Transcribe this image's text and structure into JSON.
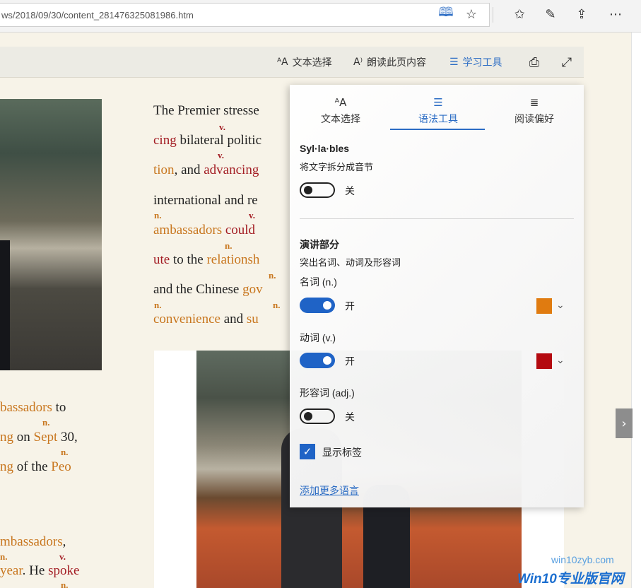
{
  "address_bar": {
    "url": "ws/2018/09/30/content_281476325081986.htm",
    "icons": [
      "reading-view-icon",
      "favorite-star-icon",
      "favorites-list-icon",
      "ink-pen-icon",
      "share-icon",
      "more-icon"
    ]
  },
  "reading_toolbar": {
    "text_options": "文本选择",
    "read_aloud": "朗读此页内容",
    "learning_tools": "学习工具",
    "icons": [
      "text-size-icon",
      "read-aloud-icon",
      "learning-tools-icon",
      "print-icon",
      "fullscreen-icon"
    ]
  },
  "article": {
    "lines": [
      {
        "segments": [
          {
            "t": "The Premier stresse",
            "c": "plain"
          }
        ]
      },
      {
        "segments": [
          {
            "t": "cing",
            "c": "verb"
          },
          {
            "t": " bilateral politic",
            "c": "plain"
          }
        ]
      },
      {
        "segments": [
          {
            "t": "tion",
            "c": "noun"
          },
          {
            "t": ", and ",
            "c": "plain"
          },
          {
            "t": "advancing",
            "c": "verb"
          }
        ]
      },
      {
        "segments": [
          {
            "t": "international and re",
            "c": "plain"
          }
        ]
      },
      {
        "segments": [
          {
            "t": "ambassadors",
            "c": "noun"
          },
          {
            "t": " ",
            "c": "plain"
          },
          {
            "t": "could",
            "c": "verb"
          }
        ]
      },
      {
        "segments": [
          {
            "t": "ute",
            "c": "verb"
          },
          {
            "t": " to the ",
            "c": "plain"
          },
          {
            "t": "relationsh",
            "c": "noun"
          }
        ]
      },
      {
        "segments": [
          {
            "t": "and the Chinese ",
            "c": "plain"
          },
          {
            "t": "gov",
            "c": "noun"
          }
        ]
      },
      {
        "segments": [
          {
            "t": "convenience",
            "c": "noun"
          },
          {
            "t": " and ",
            "c": "plain"
          },
          {
            "t": "su",
            "c": "noun"
          }
        ]
      }
    ],
    "left_lines": [
      {
        "segments": [
          {
            "t": "bassadors",
            "c": "noun"
          },
          {
            "t": " to",
            "c": "plain"
          }
        ]
      },
      {
        "segments": [
          {
            "t": "ng",
            "c": "noun"
          },
          {
            "t": " on ",
            "c": "plain"
          },
          {
            "t": "Sept",
            "c": "noun"
          },
          {
            "t": " 30,",
            "c": "plain"
          }
        ]
      },
      {
        "segments": [
          {
            "t": "ng",
            "c": "noun"
          },
          {
            "t": " of the ",
            "c": "plain"
          },
          {
            "t": "Peo",
            "c": "noun"
          }
        ]
      },
      {
        "segments": [
          {
            "t": "mbassadors",
            "c": "noun"
          },
          {
            "t": ",",
            "c": "plain"
          }
        ]
      },
      {
        "segments": [
          {
            "t": "year",
            "c": "noun"
          },
          {
            "t": ". He ",
            "c": "plain"
          },
          {
            "t": "spoke",
            "c": "verb"
          }
        ]
      }
    ],
    "tag_noun": "n.",
    "tag_verb": "v."
  },
  "panel": {
    "tabs": [
      {
        "label": "文本选择",
        "icon": "text-size-icon"
      },
      {
        "label": "语法工具",
        "icon": "grammar-tools-icon"
      },
      {
        "label": "阅读偏好",
        "icon": "reading-preferences-icon"
      }
    ],
    "active_tab": 1,
    "syllables": {
      "title": "Syl·la·bles",
      "desc": "将文字拆分成音节",
      "state": "关",
      "on": false
    },
    "parts_of_speech": {
      "title": "演讲部分",
      "desc": "突出名词、动词及形容词"
    },
    "noun": {
      "label": "名词 (n.)",
      "state": "开",
      "on": true,
      "color": "#e07b10"
    },
    "verb": {
      "label": "动词 (v.)",
      "state": "开",
      "on": true,
      "color": "#b40a10"
    },
    "adjective": {
      "label": "形容词 (adj.)",
      "state": "关",
      "on": false
    },
    "show_labels": {
      "label": "显示标签",
      "checked": true
    },
    "add_languages": "添加更多语言"
  },
  "watermark": {
    "url": "win10zyb.com",
    "brand": "Win10专业版官网"
  }
}
